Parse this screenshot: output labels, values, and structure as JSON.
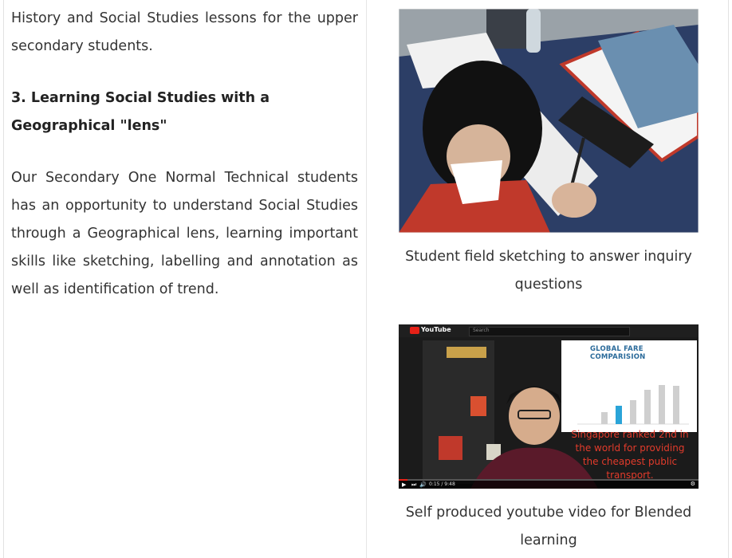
{
  "left_column": {
    "intro_paragraph": "History and Social Studies lessons for the upper secondary students.",
    "section_heading": "3. Learning Social Studies with a Geographical \"lens\"",
    "body_paragraph": "Our Secondary One Normal Technical students has an opportunity to understand Social Studies through a Geographical lens, learning important skills like sketching, labelling and annotation as well as identification of trend."
  },
  "right_column": {
    "photo1_caption": "Student field sketching to answer inquiry questions",
    "photo2_caption": "Self produced youtube video for Blended learning",
    "video": {
      "logo_text": "YouTube",
      "search_placeholder": "Search",
      "time": "0:15 / 9:48",
      "progress": 0.03,
      "chart_title": "GLOBAL FARE COMPARISION",
      "overlay": "Singapore ranked 2nd in the world for providing the cheapest public transport."
    }
  },
  "colors": {
    "text": "#333333",
    "heading": "#222222",
    "overlay_red": "#e23b2b",
    "chart_title_blue": "#2a6a9a"
  }
}
